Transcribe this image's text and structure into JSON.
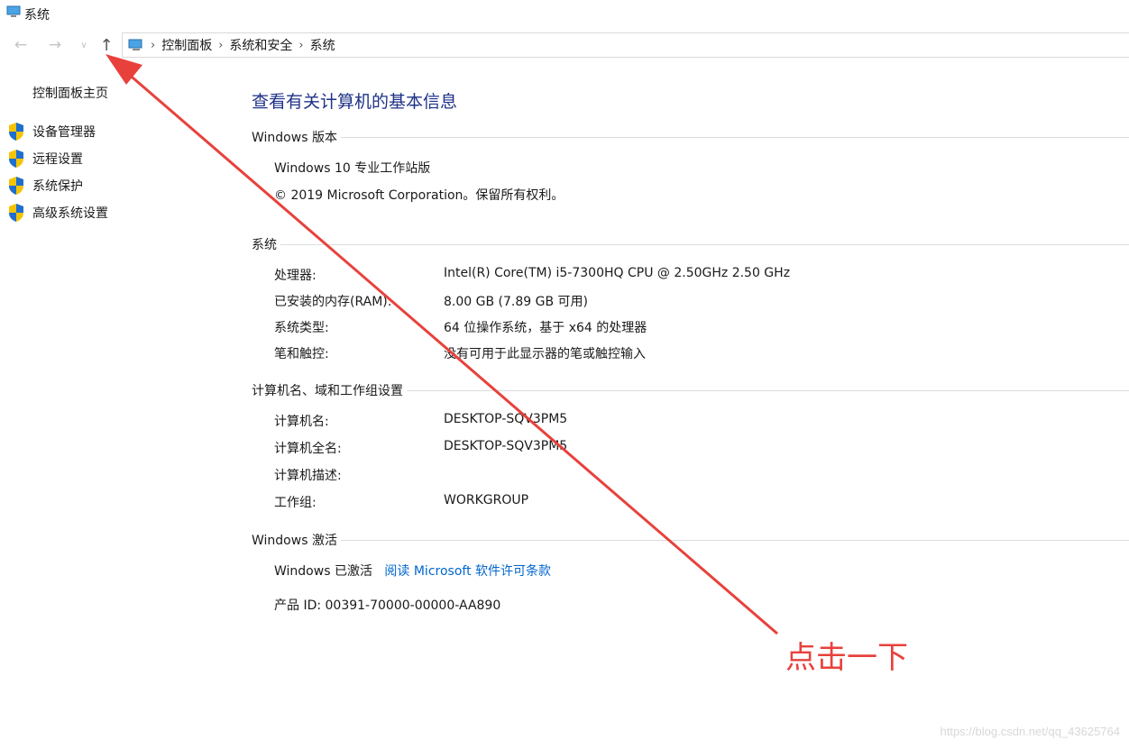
{
  "window": {
    "title": "系统",
    "icon": "system-monitor-icon"
  },
  "navigation": {
    "back_icon": "back-arrow-icon",
    "forward_icon": "forward-arrow-icon",
    "recent_icon": "chevron-down-icon",
    "up_icon": "up-arrow-icon",
    "breadcrumbs": [
      "控制面板",
      "系统和安全",
      "系统"
    ]
  },
  "sidebar": {
    "home_link": "控制面板主页",
    "tasks": [
      {
        "label": "设备管理器",
        "icon": "shield-icon"
      },
      {
        "label": "远程设置",
        "icon": "shield-icon"
      },
      {
        "label": "系统保护",
        "icon": "shield-icon"
      },
      {
        "label": "高级系统设置",
        "icon": "shield-icon"
      }
    ]
  },
  "main": {
    "title": "查看有关计算机的基本信息",
    "windows_edition": {
      "heading": "Windows 版本",
      "edition": "Windows 10 专业工作站版",
      "copyright": "© 2019 Microsoft Corporation。保留所有权利。"
    },
    "system": {
      "heading": "系统",
      "rows": [
        {
          "label": "处理器:",
          "value": "Intel(R) Core(TM) i5-7300HQ CPU @ 2.50GHz   2.50 GHz"
        },
        {
          "label": "已安装的内存(RAM):",
          "value": "8.00 GB (7.89 GB 可用)"
        },
        {
          "label": "系统类型:",
          "value": "64 位操作系统，基于 x64 的处理器"
        },
        {
          "label": "笔和触控:",
          "value": "没有可用于此显示器的笔或触控输入"
        }
      ]
    },
    "computer_name": {
      "heading": "计算机名、域和工作组设置",
      "rows": [
        {
          "label": "计算机名:",
          "value": "DESKTOP-SQV3PM5"
        },
        {
          "label": "计算机全名:",
          "value": "DESKTOP-SQV3PM5"
        },
        {
          "label": "计算机描述:",
          "value": ""
        },
        {
          "label": "工作组:",
          "value": "WORKGROUP"
        }
      ]
    },
    "activation": {
      "heading": "Windows 激活",
      "status": "Windows 已激活",
      "license_link": "阅读 Microsoft 软件许可条款",
      "product_id": "产品 ID: 00391-70000-00000-AA890"
    }
  },
  "annotation": {
    "note": "点击一下",
    "color": "#e8413c"
  },
  "watermark": "https://blog.csdn.net/qq_43625764",
  "colors": {
    "title_blue": "#1e3287",
    "link_blue": "#0066cc",
    "shield_blue": "#1f6fd1",
    "shield_yellow": "#f5c400"
  }
}
